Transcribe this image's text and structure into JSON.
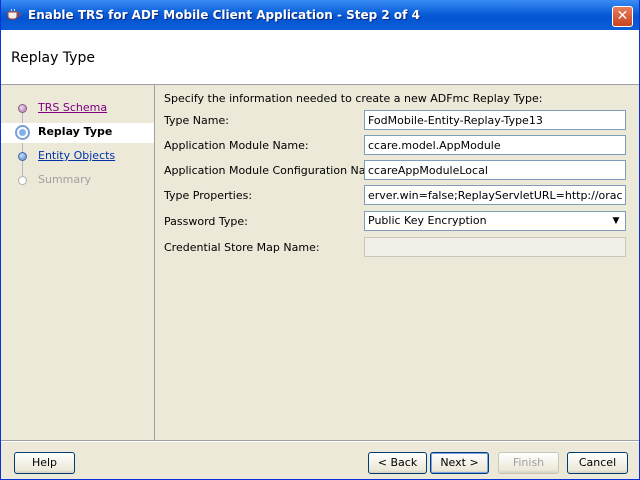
{
  "window": {
    "title": "Enable TRS for ADF Mobile Client Application - Step 2 of 4",
    "close_glyph": "✕",
    "app_icon": "coffee-cup-icon"
  },
  "header": {
    "title": "Replay Type"
  },
  "nav": {
    "steps": [
      {
        "label": "TRS Schema",
        "state": "visited"
      },
      {
        "label": "Replay Type",
        "state": "current"
      },
      {
        "label": "Entity Objects",
        "state": "link"
      },
      {
        "label": "Summary",
        "state": "disabled"
      }
    ]
  },
  "form": {
    "instruction": "Specify the information needed to create a new ADFmc Replay Type:",
    "type_name": {
      "label": "Type Name:",
      "value": "FodMobile-Entity-Replay-Type13"
    },
    "app_module_name": {
      "label": "Application Module Name:",
      "value": "ccare.model.AppModule"
    },
    "app_module_config_name": {
      "label": "Application Module Configuration Name:",
      "value": "ccareAppModuleLocal"
    },
    "type_properties": {
      "label": "Type Properties:",
      "value": "erver.win=false;ReplayServletURL=http://oracle.com"
    },
    "password_type": {
      "label": "Password Type:",
      "value": "Public Key Encryption"
    },
    "credential_store_map_name": {
      "label": "Credential Store Map Name:",
      "value": ""
    }
  },
  "footer": {
    "help": "Help",
    "back": "< Back",
    "next": "Next >",
    "finish": "Finish",
    "cancel": "Cancel"
  },
  "colors": {
    "titlebar": "#0a5fd8",
    "visited_link": "#800080",
    "link": "#0033aa",
    "disabled_text": "#a0a0a0"
  }
}
